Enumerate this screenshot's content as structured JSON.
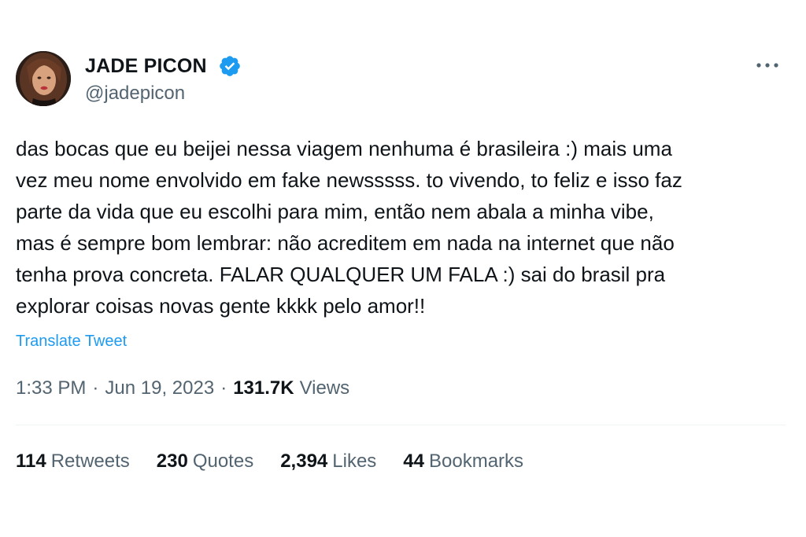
{
  "author": {
    "display_name": "JADE PICON",
    "handle": "@jadepicon",
    "verified": true
  },
  "tweet": {
    "text": "das bocas que eu beijei nessa viagem nenhuma é brasileira :) mais uma\nvez meu nome envolvido em fake newsssss. to vivendo, to feliz e isso faz\nparte da vida que eu escolhi para mim, então nem abala a minha vibe,\nmas é sempre bom lembrar: não acreditem em nada na internet que não\ntenha prova concreta. FALAR QUALQUER UM FALA :) sai do brasil pra\nexplorar coisas novas gente kkkk pelo amor!!",
    "translate_label": "Translate Tweet"
  },
  "meta": {
    "time": "1:33 PM",
    "separator": "·",
    "date": "Jun 19, 2023",
    "views_count": "131.7K",
    "views_label": "Views"
  },
  "stats": {
    "retweets": {
      "count": "114",
      "label": "Retweets"
    },
    "quotes": {
      "count": "230",
      "label": "Quotes"
    },
    "likes": {
      "count": "2,394",
      "label": "Likes"
    },
    "bookmarks": {
      "count": "44",
      "label": "Bookmarks"
    }
  },
  "icons": {
    "verified": "verified-badge-icon",
    "more": "more-options-icon"
  },
  "colors": {
    "accent": "#1d9bf0",
    "text_primary": "#0f1419",
    "text_secondary": "#536471",
    "divider": "#eff3f4"
  }
}
